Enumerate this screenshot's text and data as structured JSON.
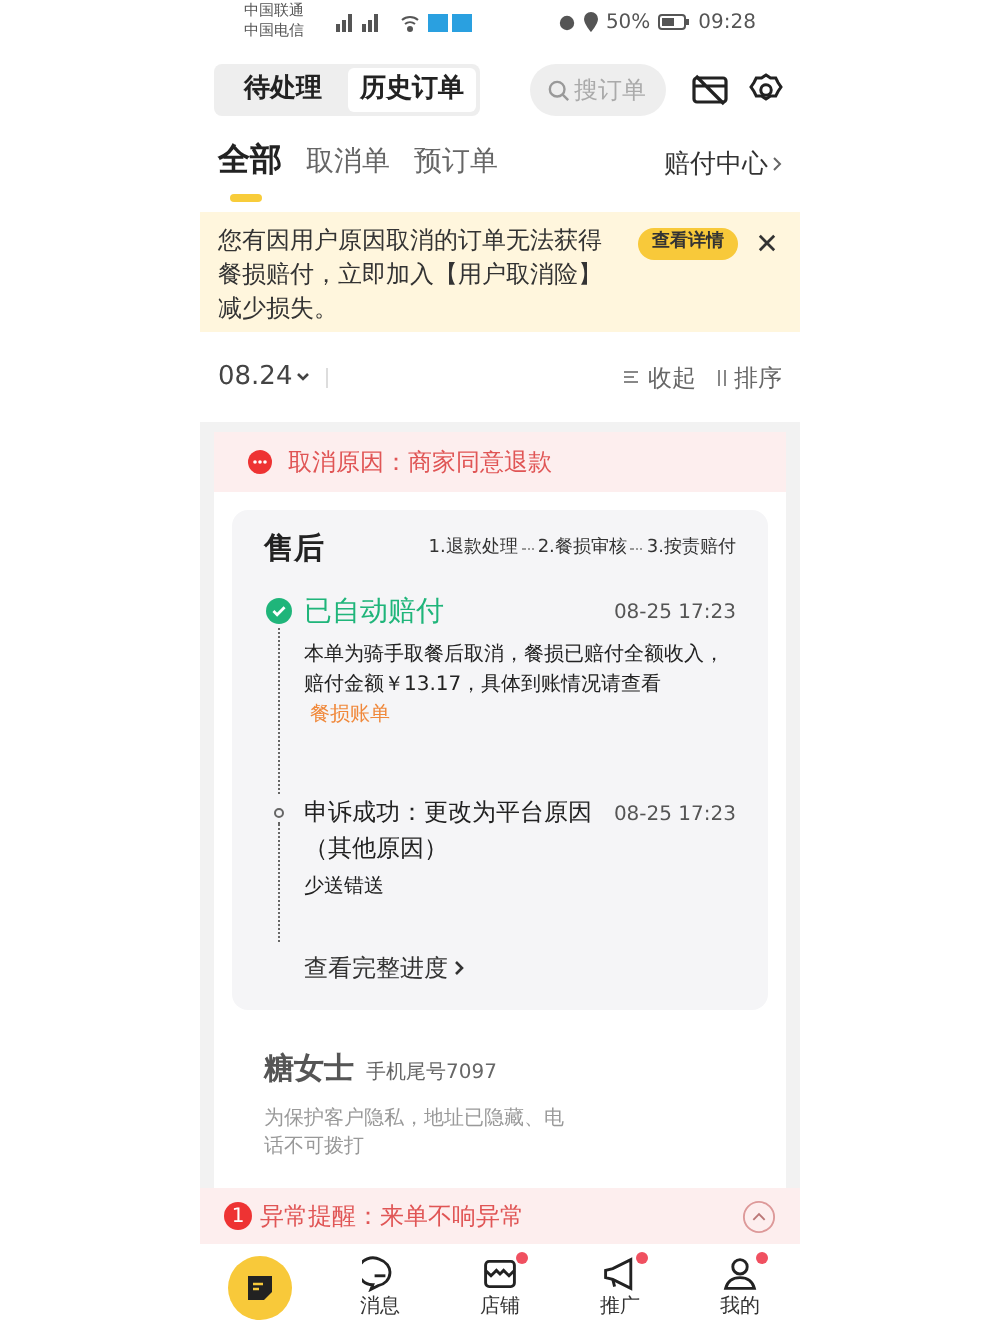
{
  "status_bar": {
    "carriers": [
      "中国联通",
      "中国电信"
    ],
    "battery": "50%",
    "time": "09:28"
  },
  "header": {
    "segments": [
      {
        "label": "待处理",
        "selected": false
      },
      {
        "label": "历史订单",
        "selected": true
      }
    ],
    "search": {
      "placeholder": "搜订单"
    }
  },
  "tabs": [
    {
      "label": "全部",
      "selected": true
    },
    {
      "label": "取消单",
      "selected": false
    },
    {
      "label": "预订单",
      "selected": false
    }
  ],
  "compensation_link": "赔付中心",
  "notice": {
    "text": "您有因用户原因取消的订单无法获得餐损赔付，立即加入【用户取消险】减少损失。",
    "button": "查看详情"
  },
  "date_bar": {
    "date": "08.24",
    "collapse": "收起",
    "sort": "排序"
  },
  "order": {
    "cancel_reason": "取消原因：商家同意退款",
    "after_sale": {
      "title": "售后",
      "steps": [
        "1.退款处理",
        "2.餐损审核",
        "3.按责赔付"
      ],
      "events": [
        {
          "kind": "done",
          "title": "已自动赔付",
          "time": "08-25 17:23",
          "description": "本单为骑手取餐后取消，餐损已赔付全额收入，赔付金额￥13.17，具体到账情况请查看",
          "link": "餐损账单"
        },
        {
          "kind": "normal",
          "title": "申诉成功：更改为平台原因（其他原因）",
          "time": "08-25 17:23",
          "description": "少送错送"
        }
      ],
      "more": "查看完整进度"
    },
    "customer": {
      "name": "糖女士",
      "phone": "手机尾号7097",
      "privacy": "为保护客户隐私，地址已隐藏、电话不可拨打"
    }
  },
  "alert": {
    "count": "1",
    "text": "异常提醒：来单不响异常"
  },
  "nav": [
    {
      "kind": "orders"
    },
    {
      "kind": "message",
      "label": "消息",
      "badge": false
    },
    {
      "kind": "shop",
      "label": "店铺",
      "badge": true
    },
    {
      "kind": "promo",
      "label": "推广",
      "badge": true
    },
    {
      "kind": "me",
      "label": "我的",
      "badge": true
    }
  ]
}
